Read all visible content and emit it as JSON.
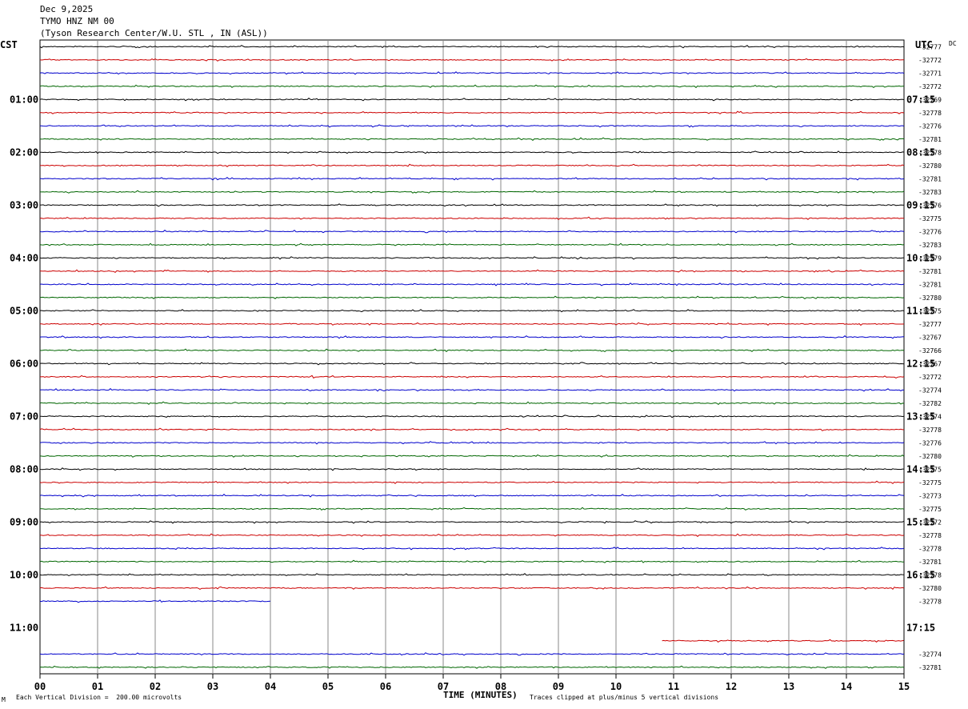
{
  "header": {
    "date": "Dec 9,2025",
    "station": "TYMO HNZ NM 00",
    "location": "(Tyson Research Center/W.U. STL , IN (ASL))"
  },
  "left_zone": "CST",
  "right_zone": "UTC",
  "dc_label": "DC",
  "footer": {
    "left_note": "Each Vertical Division =  200.00 microvolts",
    "x_axis_title": "TIME (MINUTES)",
    "right_note": "Traces clipped at plus/minus 5 vertical divisions",
    "corner_mark": "M"
  },
  "colors": {
    "black": "#000000",
    "red": "#cc0000",
    "blue": "#0000cc",
    "green": "#006600",
    "grid": "#888888"
  },
  "chart_data": {
    "type": "line",
    "title": "TYMO HNZ NM 00",
    "xlabel": "TIME (MINUTES)",
    "xlim": [
      0,
      15
    ],
    "x_ticks": [
      "00",
      "01",
      "02",
      "03",
      "04",
      "05",
      "06",
      "07",
      "08",
      "09",
      "10",
      "11",
      "12",
      "13",
      "14",
      "15"
    ],
    "left_hour_labels": [
      "01:00",
      "02:00",
      "03:00",
      "04:00",
      "05:00",
      "06:00",
      "07:00",
      "08:00",
      "09:00",
      "10:00",
      "11:00"
    ],
    "right_hour_labels": [
      "07:15",
      "08:15",
      "09:15",
      "10:15",
      "11:15",
      "12:15",
      "13:15",
      "14:15",
      "15:15",
      "16:15",
      "17:15"
    ],
    "trace_color_cycle": [
      "black",
      "red",
      "blue",
      "green"
    ],
    "trace_count": 48,
    "traces": [
      {
        "row": 0,
        "color": "black",
        "dc": "-32777"
      },
      {
        "row": 1,
        "color": "red",
        "dc": "-32772"
      },
      {
        "row": 2,
        "color": "blue",
        "dc": "-32771"
      },
      {
        "row": 3,
        "color": "green",
        "dc": "-32772"
      },
      {
        "row": 4,
        "color": "black",
        "dc": "-32769"
      },
      {
        "row": 5,
        "color": "red",
        "dc": "-32778"
      },
      {
        "row": 6,
        "color": "blue",
        "dc": "-32776"
      },
      {
        "row": 7,
        "color": "green",
        "dc": "-32781"
      },
      {
        "row": 8,
        "color": "black",
        "dc": "-32778"
      },
      {
        "row": 9,
        "color": "red",
        "dc": "-32780"
      },
      {
        "row": 10,
        "color": "blue",
        "dc": "-32781"
      },
      {
        "row": 11,
        "color": "green",
        "dc": "-32783"
      },
      {
        "row": 12,
        "color": "black",
        "dc": "-32776"
      },
      {
        "row": 13,
        "color": "red",
        "dc": "-32775"
      },
      {
        "row": 14,
        "color": "blue",
        "dc": "-32776"
      },
      {
        "row": 15,
        "color": "green",
        "dc": "-32783"
      },
      {
        "row": 16,
        "color": "black",
        "dc": "-32779"
      },
      {
        "row": 17,
        "color": "red",
        "dc": "-32781"
      },
      {
        "row": 18,
        "color": "blue",
        "dc": "-32781"
      },
      {
        "row": 19,
        "color": "green",
        "dc": "-32780"
      },
      {
        "row": 20,
        "color": "black",
        "dc": "-32775"
      },
      {
        "row": 21,
        "color": "red",
        "dc": "-32777"
      },
      {
        "row": 22,
        "color": "blue",
        "dc": "-32767"
      },
      {
        "row": 23,
        "color": "green",
        "dc": "-32766"
      },
      {
        "row": 24,
        "color": "black",
        "dc": "-32767"
      },
      {
        "row": 25,
        "color": "red",
        "dc": "-32772"
      },
      {
        "row": 26,
        "color": "blue",
        "dc": "-32774"
      },
      {
        "row": 27,
        "color": "green",
        "dc": "-32782"
      },
      {
        "row": 28,
        "color": "black",
        "dc": "-32774"
      },
      {
        "row": 29,
        "color": "red",
        "dc": "-32778"
      },
      {
        "row": 30,
        "color": "blue",
        "dc": "-32776"
      },
      {
        "row": 31,
        "color": "green",
        "dc": "-32780"
      },
      {
        "row": 32,
        "color": "black",
        "dc": "-32775"
      },
      {
        "row": 33,
        "color": "red",
        "dc": "-32775"
      },
      {
        "row": 34,
        "color": "blue",
        "dc": "-32773"
      },
      {
        "row": 35,
        "color": "green",
        "dc": "-32775"
      },
      {
        "row": 36,
        "color": "black",
        "dc": "-32772"
      },
      {
        "row": 37,
        "color": "red",
        "dc": "-32778"
      },
      {
        "row": 38,
        "color": "blue",
        "dc": "-32778"
      },
      {
        "row": 39,
        "color": "green",
        "dc": "-32781"
      },
      {
        "row": 40,
        "color": "black",
        "dc": "-32778"
      },
      {
        "row": 41,
        "color": "red",
        "dc": "-32780"
      },
      {
        "row": 42,
        "color": "blue",
        "dc": "-32778",
        "end_minute": 4
      },
      {
        "row": 45,
        "color": "red",
        "dc": "",
        "start_minute": 10.8
      },
      {
        "row": 46,
        "color": "blue",
        "dc": "-32774"
      },
      {
        "row": 47,
        "color": "green",
        "dc": "-32781"
      }
    ]
  }
}
